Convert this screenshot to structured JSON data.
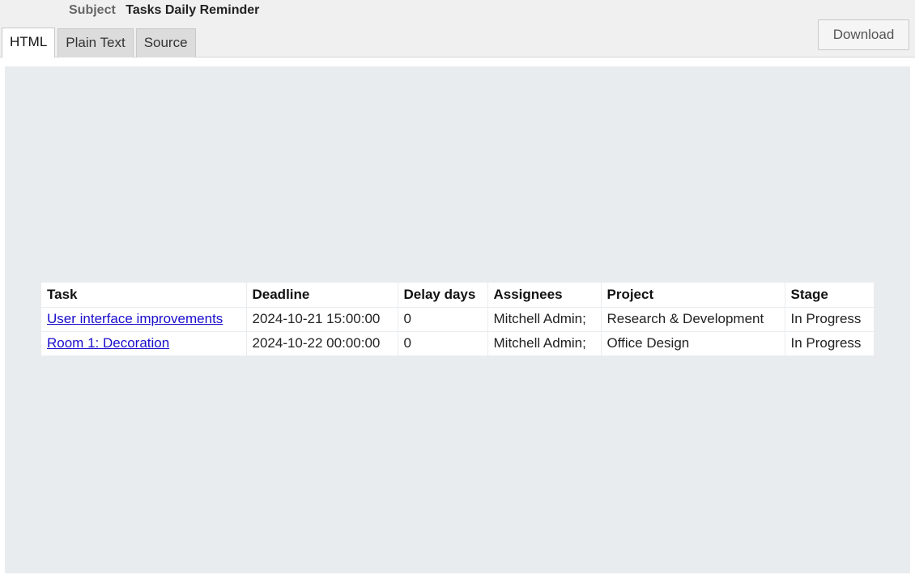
{
  "header": {
    "subject_label": "Subject",
    "subject_value": "Tasks Daily Reminder",
    "download_label": "Download"
  },
  "tabs": [
    {
      "label": "HTML",
      "active": true
    },
    {
      "label": "Plain Text",
      "active": false
    },
    {
      "label": "Source",
      "active": false
    }
  ],
  "table": {
    "columns": [
      "Task",
      "Deadline",
      "Delay days",
      "Assignees",
      "Project",
      "Stage"
    ],
    "rows": [
      {
        "task": "User interface improvements",
        "deadline": "2024-10-21 15:00:00",
        "delay_days": "0",
        "assignees": "Mitchell Admin;",
        "project": "Research & Development",
        "stage": "In Progress"
      },
      {
        "task": "Room 1: Decoration",
        "deadline": "2024-10-22 00:00:00",
        "delay_days": "0",
        "assignees": "Mitchell Admin;",
        "project": "Office Design",
        "stage": "In Progress"
      }
    ]
  },
  "colors": {
    "link": "#1a0dcc",
    "preview_background": "#e9ecef",
    "header_background": "#f0f0f0"
  }
}
